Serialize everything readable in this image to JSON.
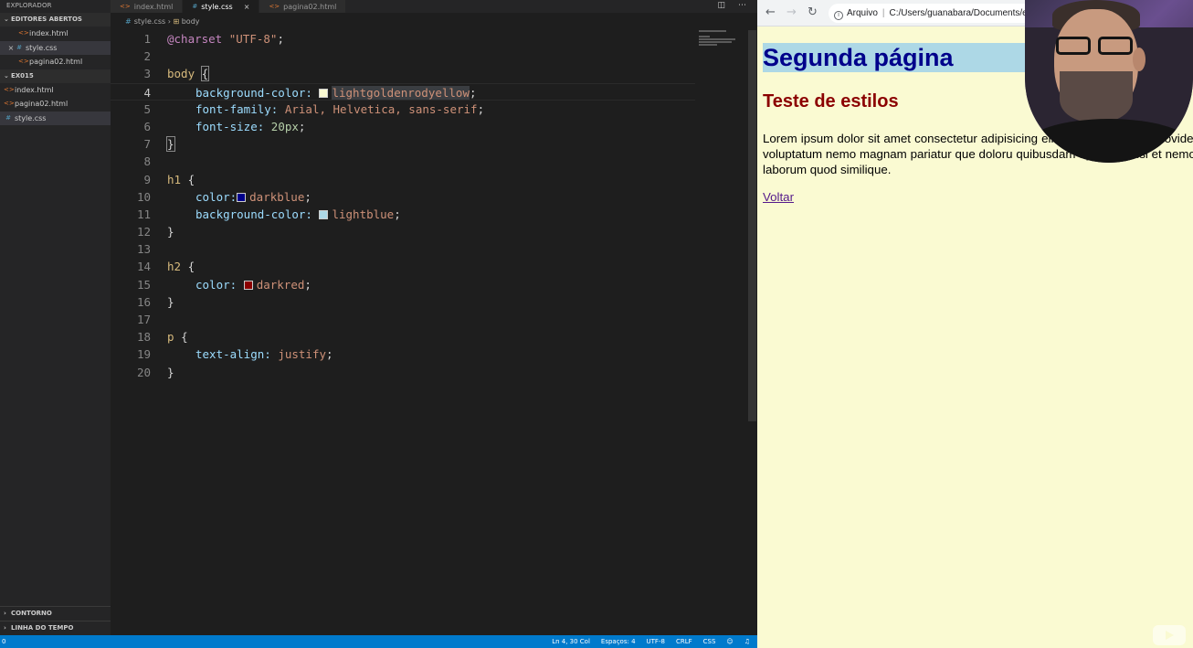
{
  "vscode": {
    "explorer_title": "EXPLORADOR",
    "open_editors_title": "EDITORES ABERTOS",
    "open_editors": [
      {
        "name": "index.html",
        "type": "html"
      },
      {
        "name": "style.css",
        "type": "css"
      },
      {
        "name": "pagina02.html",
        "type": "html"
      }
    ],
    "folder_title": "EX015",
    "folder_files": [
      {
        "name": "index.html",
        "type": "html"
      },
      {
        "name": "pagina02.html",
        "type": "html"
      },
      {
        "name": "style.css",
        "type": "css"
      }
    ],
    "outline_title": "CONTORNO",
    "timeline_title": "LINHA DO TEMPO",
    "tabs": [
      {
        "label": "index.html",
        "type": "html"
      },
      {
        "label": "style.css",
        "type": "css"
      },
      {
        "label": "pagina02.html",
        "type": "html"
      }
    ],
    "breadcrumb": {
      "file": "style.css",
      "symbol": "body"
    },
    "line_numbers": [
      "1",
      "2",
      "3",
      "4",
      "5",
      "6",
      "7",
      "8",
      "9",
      "10",
      "11",
      "12",
      "13",
      "14",
      "15",
      "16",
      "17",
      "18",
      "19",
      "20"
    ],
    "code": {
      "charset_kw": "@charset",
      "charset_val": "\"UTF-8\"",
      "body_sel": "body",
      "body_bg_prop": "background-color:",
      "body_bg_val": "lightgoldenrodyellow",
      "body_ff_prop": "font-family:",
      "body_ff_val": "Arial, Helvetica, sans-serif",
      "body_fs_prop": "font-size:",
      "body_fs_val": "20px",
      "h1_sel": "h1",
      "h1_color_prop": "color:",
      "h1_color_val": "darkblue",
      "h1_bg_prop": "background-color:",
      "h1_bg_val": "lightblue",
      "h2_sel": "h2",
      "h2_color_prop": "color:",
      "h2_color_val": "darkred",
      "p_sel": "p",
      "p_ta_prop": "text-align:",
      "p_ta_val": "justify"
    },
    "swatch_colors": {
      "lightgoldenrodyellow": "#fafad2",
      "darkblue": "#00008b",
      "lightblue": "#add8e6",
      "darkred": "#8b0000"
    },
    "status": {
      "left": "0",
      "position": "Ln 4, 30 Col",
      "spaces": "Espaços: 4",
      "encoding": "UTF-8",
      "eol": "CRLF",
      "language": "CSS"
    }
  },
  "browser": {
    "address_label": "Arquivo",
    "url": "C:/Users/guanabara/Documents/estudo",
    "page": {
      "h1": "Segunda página",
      "h2": "Teste de estilos",
      "paragraph": "Lorem ipsum dolor sit amet consectetur adipisicing elit. Quod. Qui quas provident, dolor voluptatum nemo magnam pariatur que doloru quibusdam aperiam, nisi et nemo vel odit laborum quod similique.",
      "link": "Voltar"
    }
  }
}
